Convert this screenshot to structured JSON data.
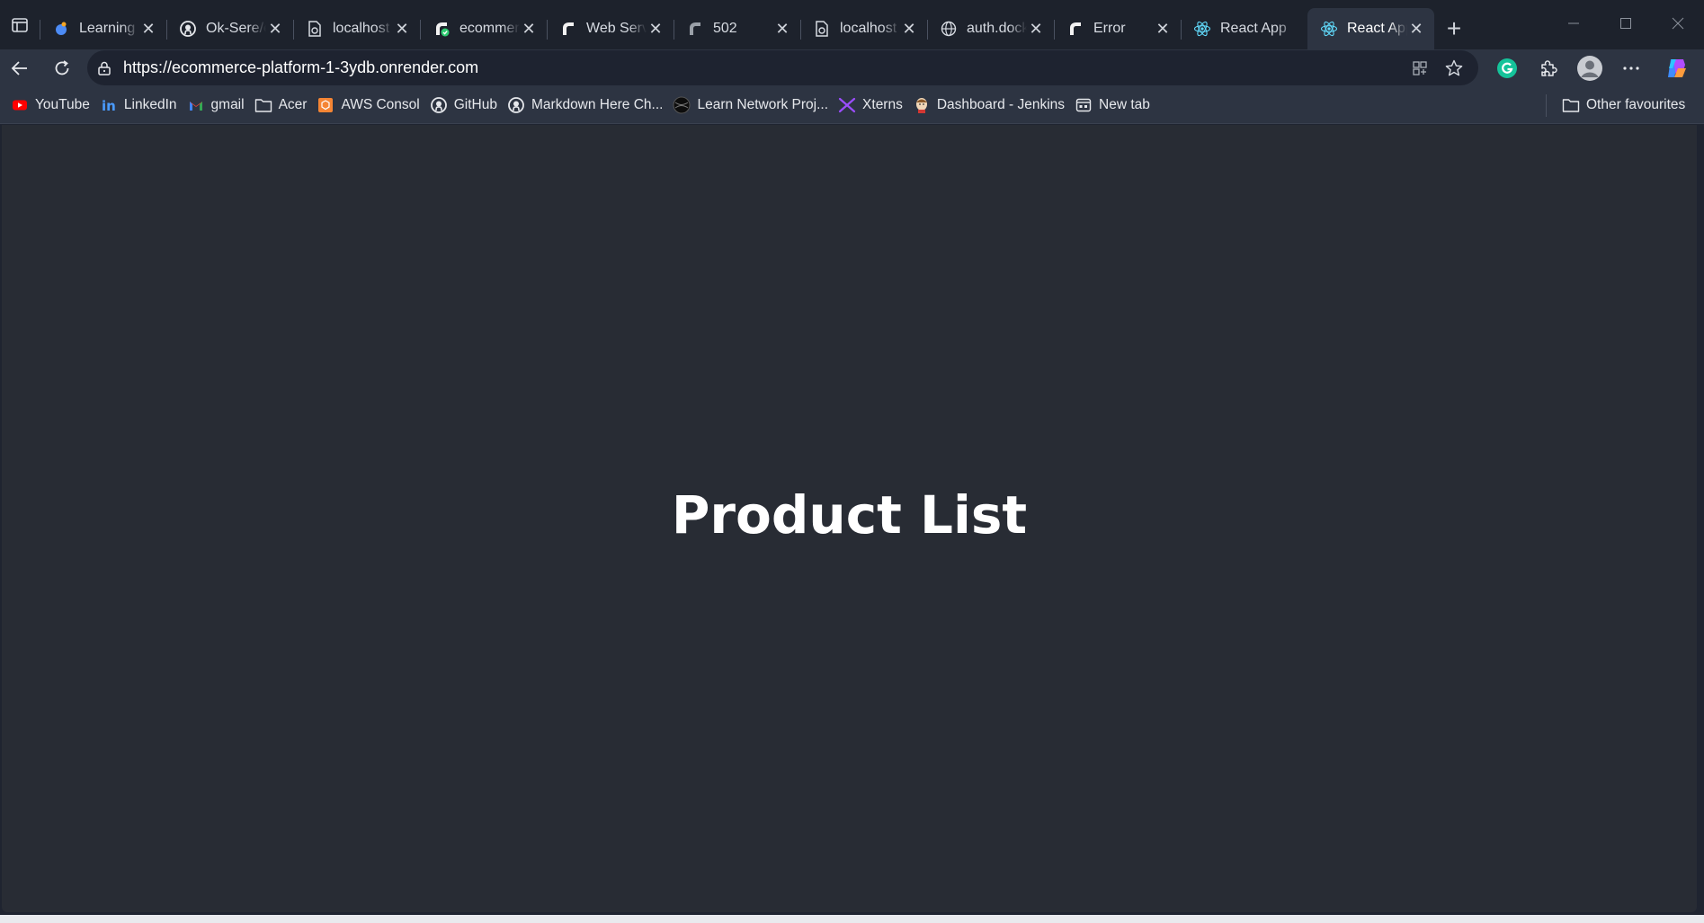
{
  "browser": {
    "tabs": [
      {
        "title": "Learning Paths",
        "icon": "learning-icon",
        "active": false
      },
      {
        "title": "Ok-Sere/ecommerce",
        "icon": "github-icon",
        "active": false
      },
      {
        "title": "localhost",
        "icon": "page-error-icon",
        "active": false
      },
      {
        "title": "ecommerce-platform",
        "icon": "render-check-icon",
        "active": false
      },
      {
        "title": "Web Services",
        "icon": "render-icon",
        "active": false
      },
      {
        "title": "502",
        "icon": "render-gray-icon",
        "active": false
      },
      {
        "title": "localhost",
        "icon": "page-error-icon",
        "active": false
      },
      {
        "title": "auth.docker.io",
        "icon": "globe-icon",
        "active": false
      },
      {
        "title": "Error",
        "icon": "render-icon",
        "active": false
      },
      {
        "title": "React App",
        "icon": "react-icon",
        "active": false
      },
      {
        "title": "React App",
        "icon": "react-icon",
        "active": true
      }
    ],
    "address_url": "https://ecommerce-platform-1-3ydb.onrender.com",
    "bookmarks": [
      {
        "label": "YouTube",
        "icon": "youtube-icon"
      },
      {
        "label": "LinkedIn",
        "icon": "linkedin-icon"
      },
      {
        "label": "gmail",
        "icon": "gmail-icon"
      },
      {
        "label": "Acer",
        "icon": "folder-icon"
      },
      {
        "label": "AWS Consol",
        "icon": "aws-icon"
      },
      {
        "label": "GitHub",
        "icon": "github-icon"
      },
      {
        "label": "Markdown Here Ch...",
        "icon": "github-icon"
      },
      {
        "label": "Learn Network Proj...",
        "icon": "network-icon"
      },
      {
        "label": "Xterns",
        "icon": "xterns-icon"
      },
      {
        "label": "Dashboard - Jenkins",
        "icon": "jenkins-icon"
      },
      {
        "label": "New tab",
        "icon": "newtab-icon"
      }
    ],
    "other_favourites": "Other favourites"
  },
  "page": {
    "heading": "Product List",
    "background": "#282c34"
  }
}
